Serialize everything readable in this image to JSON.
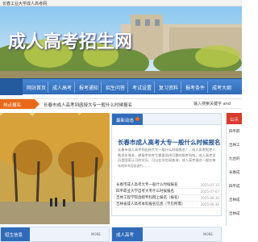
{
  "topbar": {
    "site_name": "长春工业大学成人高考网"
  },
  "banner": {
    "logo_text": "成人高考招生网"
  },
  "nav": {
    "items": [
      "网站首页",
      "成人高考",
      "报考通知",
      "招生问答",
      "考试设置",
      "复习资料",
      "报考条件",
      "成考大纲"
    ]
  },
  "notice": {
    "label": "热点报名",
    "text": "长春市成人高考到函授大专一般什么时候报名",
    "search_text": "输入搜索关键字 and"
  },
  "news": {
    "tab_label": "最新动态",
    "headline": "长春市成人高考大专一般什么时候报名",
    "summary": "长春市成人高考到函授大专一般什么时候报名？，成人高考报考人数逐年增多，想报考的考生需要选择可靠的报考机构，成人高考学历是国家认可的学历，可以在学信网查询，成人高考报名一般在每年的8-9月份进行……",
    "items": [
      {
        "title": "长春市成人高考大专一般什么时候报名",
        "date": "2025-07-15"
      },
      {
        "title": "四平职业大学自考大专什么时候报名",
        "date": "2025-07-07"
      },
      {
        "title": "吉林工程学院函授专科网上报名（报名）",
        "date": "2025-06-30"
      },
      {
        "title": "吉林省成人高考本科报名信息（学历所需）",
        "date": "2025-06-30"
      }
    ]
  },
  "right_panel": {
    "head": "公示",
    "rows": [
      "四平职",
      "吉林工",
      "九台的",
      "长春成",
      "四平成",
      "吉林成",
      "吉林成"
    ]
  },
  "bottom": {
    "left_tab": "招生信息",
    "left_more": "MORE",
    "mid_tab": "成人高考",
    "mid_more": "MORE"
  },
  "colors": {
    "nav_blue": "#2f6bb8",
    "accent_orange": "#e9691b",
    "accent_red": "#d83a2a"
  }
}
